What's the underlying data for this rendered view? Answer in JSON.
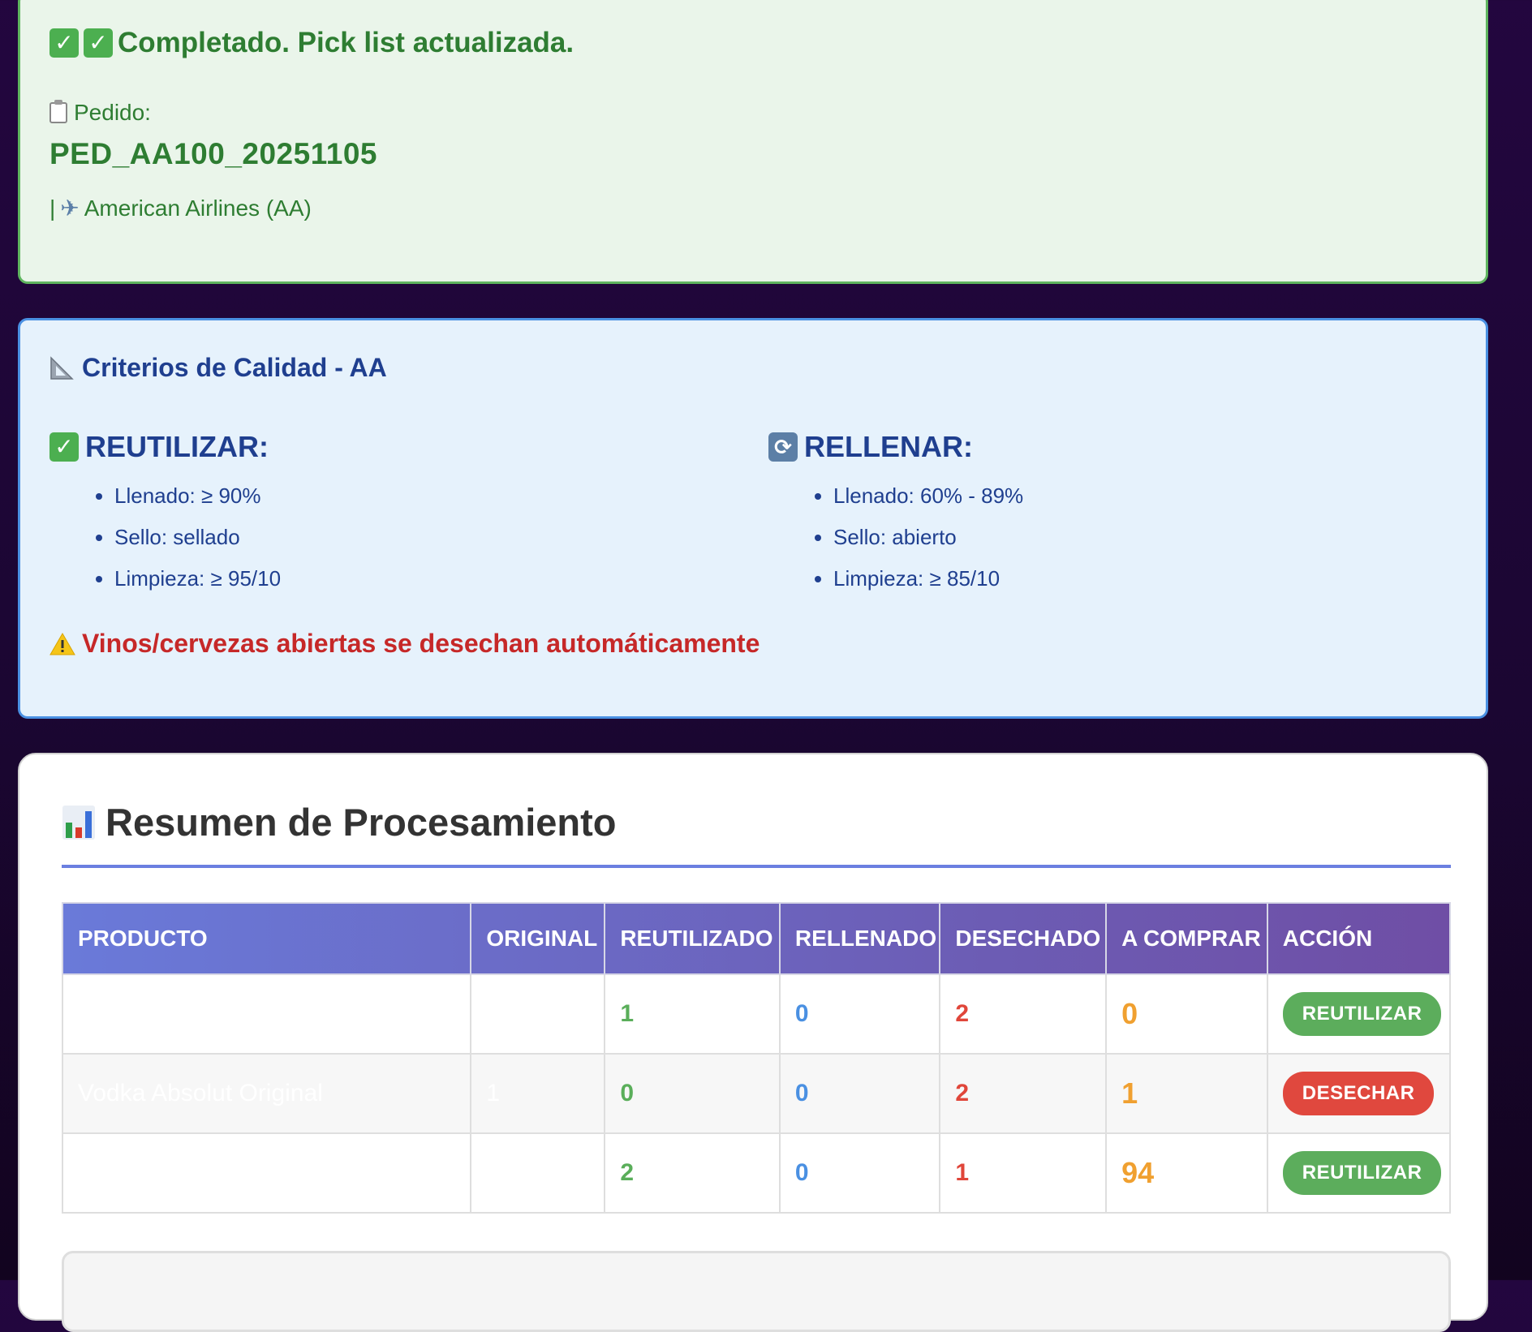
{
  "success": {
    "title": "Completado. Pick list actualizada.",
    "order_label": "Pedido:",
    "order_id": "PED_AA100_20251105",
    "airline_prefix": "|",
    "airline": "American Airlines (AA)"
  },
  "criteria": {
    "title": "Criterios de Calidad - AA",
    "reuse": {
      "heading": "REUTILIZAR:",
      "items": [
        "Llenado: ≥ 90%",
        "Sello: sellado",
        "Limpieza: ≥ 95/10"
      ]
    },
    "refill": {
      "heading": "RELLENAR:",
      "items": [
        "Llenado: 60% - 89%",
        "Sello: abierto",
        "Limpieza: ≥ 85/10"
      ]
    },
    "warning": "Vinos/cervezas abiertas se desechan automáticamente"
  },
  "summary": {
    "title": "Resumen de Procesamiento",
    "columns": [
      "PRODUCTO",
      "ORIGINAL",
      "REUTILIZADO",
      "RELLENADO",
      "DESECHADO",
      "A COMPRAR",
      "ACCIÓN"
    ],
    "rows": [
      {
        "product": "",
        "original": "",
        "reused": "1",
        "refilled": "0",
        "discarded": "2",
        "to_buy": "0",
        "action": "REUTILIZAR",
        "action_color": "#5cad5c"
      },
      {
        "product": "Vodka Absolut Original",
        "original": "1",
        "reused": "0",
        "refilled": "0",
        "discarded": "2",
        "to_buy": "1",
        "action": "DESECHAR",
        "action_color": "#e0483e"
      },
      {
        "product": "",
        "original": "",
        "reused": "2",
        "refilled": "0",
        "discarded": "1",
        "to_buy": "94",
        "action": "REUTILIZAR",
        "action_color": "#5cad5c"
      }
    ]
  },
  "colors": {
    "success_green": "#2e7d32",
    "info_blue": "#1f3f8f",
    "warning_red": "#c62828",
    "header_gradient_start": "#6a7ad9",
    "header_gradient_end": "#6f4ea5"
  }
}
